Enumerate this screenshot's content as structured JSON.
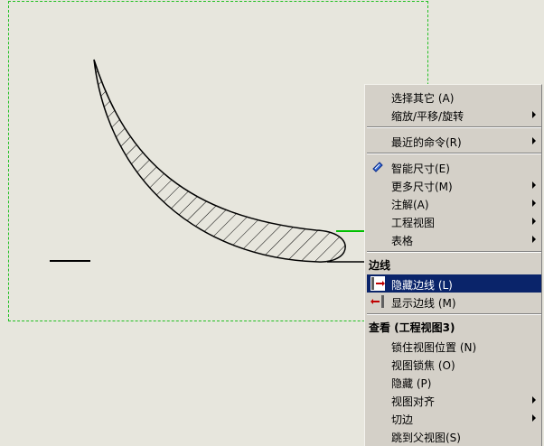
{
  "menu": {
    "items": [
      {
        "label": "选择其它 (A)",
        "submenu": false
      },
      {
        "label": "缩放/平移/旋转",
        "submenu": true
      },
      {
        "label": "最近的命令(R)",
        "submenu": true
      },
      {
        "label": "智能尺寸(E)",
        "submenu": false,
        "icon": "smart-dimension-icon"
      },
      {
        "label": "更多尺寸(M)",
        "submenu": true
      },
      {
        "label": "注解(A)",
        "submenu": true
      },
      {
        "label": "工程视图",
        "submenu": true
      },
      {
        "label": "表格",
        "submenu": true
      }
    ],
    "edge_section": {
      "header": "边线",
      "items": [
        {
          "label": "隐藏边线 (L)",
          "icon": "hide-edge-icon",
          "highlighted": true
        },
        {
          "label": "显示边线 (M)",
          "icon": "show-edge-icon",
          "highlighted": false
        }
      ]
    },
    "view_section": {
      "header": "查看 (工程视图3)",
      "items": [
        {
          "label": "锁住视图位置 (N)",
          "submenu": false
        },
        {
          "label": "视图锁焦 (O)",
          "submenu": false
        },
        {
          "label": "隐藏 (P)",
          "submenu": false
        },
        {
          "label": "视图对齐",
          "submenu": true
        },
        {
          "label": "切边",
          "submenu": true
        },
        {
          "label": "跳到父视图(S)",
          "submenu": false
        }
      ]
    }
  },
  "colors": {
    "canvas": "#e7e6dd",
    "menu_bg": "#d4d0c8",
    "highlight": "#0a246a",
    "view_border": "#22c022",
    "selected_edge": "#00c000"
  }
}
